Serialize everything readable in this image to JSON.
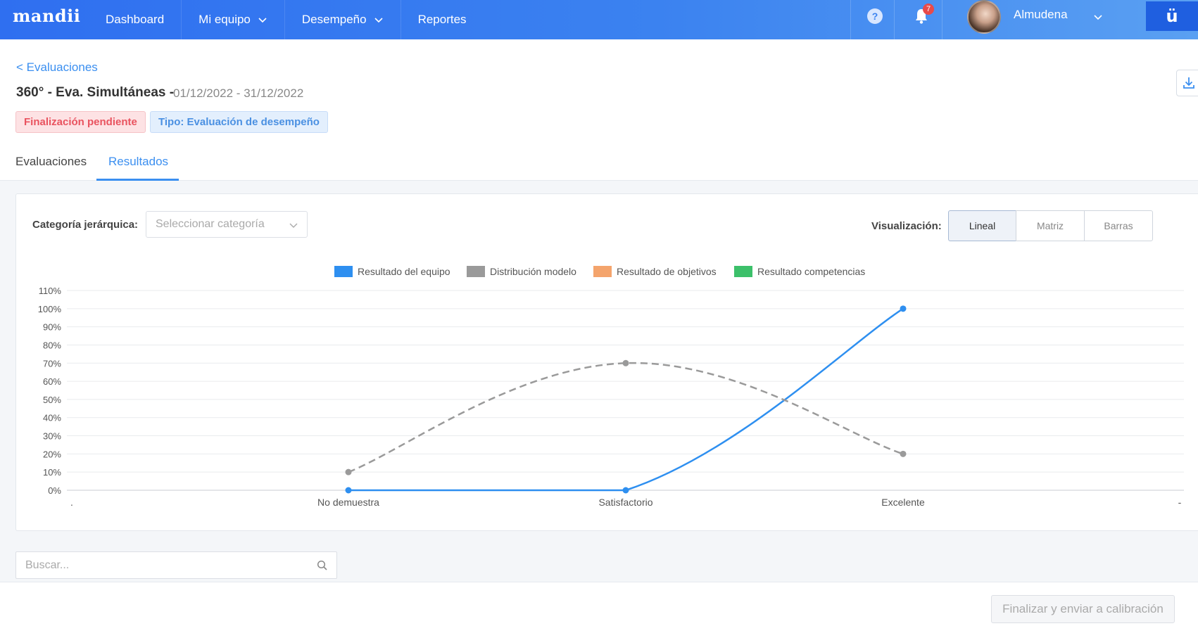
{
  "app": {
    "logo": "mandii"
  },
  "nav": {
    "items": [
      {
        "label": "Dashboard",
        "has_dropdown": false
      },
      {
        "label": "Mi equipo",
        "has_dropdown": true
      },
      {
        "label": "Desempeño",
        "has_dropdown": true
      },
      {
        "label": "Reportes",
        "has_dropdown": false
      }
    ]
  },
  "header": {
    "help_icon": "?",
    "notifications_count": "7",
    "user_name": "Almudena",
    "brand_button": "ü"
  },
  "page": {
    "back_link": "< Evaluaciones",
    "title": "360° - Eva. Simultáneas -",
    "dates": "01/12/2022 - 31/12/2022",
    "badge_status": "Finalización pendiente",
    "badge_type": "Tipo: Evaluación de desempeño"
  },
  "tabs": [
    {
      "label": "Evaluaciones",
      "active": false
    },
    {
      "label": "Resultados",
      "active": true
    }
  ],
  "filters": {
    "category_label": "Categoría jerárquica:",
    "category_placeholder": "Seleccionar categoría",
    "visualization_label": "Visualización:",
    "visualization_options": [
      "Lineal",
      "Matriz",
      "Barras"
    ],
    "visualization_selected": "Lineal"
  },
  "chart_data": {
    "type": "line",
    "categories": [
      ".",
      "No demuestra",
      "Satisfactorio",
      "Excelente",
      "-"
    ],
    "ylim": [
      0,
      110
    ],
    "yticks": [
      "0%",
      "10%",
      "20%",
      "30%",
      "40%",
      "50%",
      "60%",
      "70%",
      "80%",
      "90%",
      "100%",
      "110%"
    ],
    "legend": [
      {
        "name": "Resultado del equipo",
        "color": "#2e8ff0"
      },
      {
        "name": "Distribución modelo",
        "color": "#9a9a9a"
      },
      {
        "name": "Resultado de objetivos",
        "color": "#f4a46c"
      },
      {
        "name": "Resultado competencias",
        "color": "#3cc06a"
      }
    ],
    "series": [
      {
        "name": "Resultado del equipo",
        "style": "solid",
        "color": "#2e8ff0",
        "values": [
          null,
          0,
          0,
          100,
          null
        ]
      },
      {
        "name": "Distribución modelo",
        "style": "dashed",
        "color": "#9a9a9a",
        "values": [
          null,
          10,
          70,
          20,
          null
        ]
      }
    ],
    "grid": true,
    "legend_position": "top"
  },
  "search": {
    "placeholder": "Buscar..."
  },
  "footer": {
    "finalize_label": "Finalizar y enviar a calibración"
  }
}
